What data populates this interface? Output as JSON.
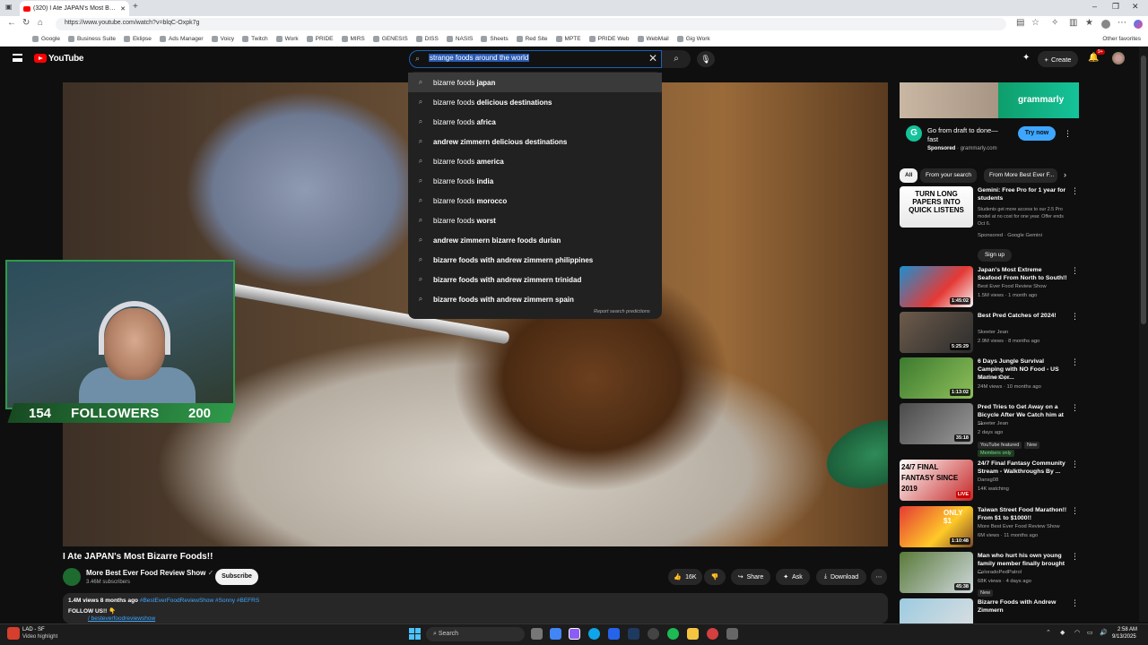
{
  "browser": {
    "tab_title": "(320) I Ate JAPAN's Most Bu...",
    "url": "https://www.youtube.com/watch?v=blqC-Oxpk7g",
    "bookmarks": [
      "Google",
      "Business Suite",
      "Eklipse",
      "Ads Manager",
      "Voicy",
      "Twitch",
      "Work",
      "PRIDE",
      "MIRS",
      "GENESIS",
      "DISS",
      "NASIS",
      "Sheets",
      "Red Site",
      "MPTE",
      "PRIDE Web",
      "WebMail",
      "Gig Work"
    ],
    "other_bookmarks": "Other favorites"
  },
  "header": {
    "logo": "YouTube",
    "search_value": "strange foods around the world",
    "create_label": "Create",
    "notif_count": "9+"
  },
  "suggestions": {
    "items": [
      {
        "prefix": "bizarre foods ",
        "bold": "japan"
      },
      {
        "prefix": "bizarre foods ",
        "bold": "delicious destinations"
      },
      {
        "prefix": "bizarre foods ",
        "bold": "africa"
      },
      {
        "prefix": "",
        "bold": "andrew zimmern delicious destinations"
      },
      {
        "prefix": "bizarre foods ",
        "bold": "america"
      },
      {
        "prefix": "bizarre foods ",
        "bold": "india"
      },
      {
        "prefix": "bizarre foods ",
        "bold": "morocco"
      },
      {
        "prefix": "bizarre foods ",
        "bold": "worst"
      },
      {
        "prefix": "",
        "bold": "andrew zimmern bizarre foods durian"
      },
      {
        "prefix": "",
        "bold": "bizarre foods with andrew zimmern philippines"
      },
      {
        "prefix": "",
        "bold": "bizarre foods with andrew zimmern trinidad"
      },
      {
        "prefix": "",
        "bold": "bizarre foods with andrew zimmern spain"
      }
    ],
    "report": "Report search predictions"
  },
  "overlay": {
    "followers_current": "154",
    "followers_label": "FOLLOWERS",
    "followers_goal": "200"
  },
  "video": {
    "title": "I Ate JAPAN's Most Bizarre Foods!!",
    "channel": "More Best Ever Food Review Show",
    "subs": "3.46M subscribers",
    "subscribe": "Subscribe",
    "likes": "16K",
    "share": "Share",
    "ask": "Ask",
    "download": "Download",
    "views_age": "1.4M views  8 months ago",
    "tags": "#BestEverFoodReviewShow #Sonny #BEFRS",
    "follow": "FOLLOW US!! 👇",
    "link": "/ besteverfoodreviewshow"
  },
  "ad": {
    "brand": "grammarly",
    "title": "Go from draft to done—fast",
    "sponsored": "Sponsored",
    "domain": "grammarly.com",
    "cta": "Try now"
  },
  "chips": [
    "All",
    "From your search",
    "From More Best Ever F..."
  ],
  "recs": [
    {
      "title": "Gemini: Free Pro for 1 year for students",
      "meta1": "Students get more access to our 2.5 Pro model at no cost for one year. Offer ends Oct 6.",
      "meta2": "Sponsored · Google Gemini",
      "duration": "",
      "thumb_text": "TURN LONG PAPERS INTO QUICK LISTENS"
    },
    {
      "title": "Japan's Most Extreme Seafood From North to South!!",
      "meta1": "Best Ever Food Review Show",
      "meta2": "1.5M views · 1 month ago",
      "duration": "1:45:02"
    },
    {
      "title": "Best Pred Catches of 2024!",
      "meta1": "Skeeter Jean",
      "meta2": "2.9M views · 8 months ago",
      "duration": "5:25:29"
    },
    {
      "title": "6 Days Jungle Survival Camping with NO Food - US Marine Cor...",
      "meta1": "Outdoor Boys",
      "meta2": "24M views · 10 months ago",
      "duration": "1:13:02"
    },
    {
      "title": "Pred Tries to Get Away on a Bicycle After We Catch him at ...",
      "meta1": "Skeeter Jean",
      "meta2": "2 days ago",
      "duration": "35:18"
    },
    {
      "title": "24/7 Final Fantasy Community Stream - Walkthroughs By ...",
      "meta1": "Dansg08",
      "meta2": "14K watching",
      "duration": "LIVE"
    },
    {
      "title": "Taiwan Street Food Marathon!! From $1 to $1000!!",
      "meta1": "More Best Ever Food Review Show",
      "meta2": "6M views · 11 months ago",
      "duration": "1:10:48"
    },
    {
      "title": "Man who hurt his own young family member finally brought ...",
      "meta1": "ColoradoPedPatrol",
      "meta2": "68K views · 4 days ago",
      "duration": "45:38"
    },
    {
      "title": "Bizarre Foods with Andrew Zimmern",
      "meta1": "",
      "meta2": "",
      "duration": ""
    }
  ],
  "rec_extras": {
    "signup": "Sign up",
    "yt_featured": "YouTube featured",
    "new": "New",
    "members": "Members only",
    "new2": "New",
    "thumb_final_fantasy": "24/7 FINAL FANTASY SINCE 2019",
    "thumb_only": "ONLY $1"
  },
  "taskbar": {
    "weather_line1": "LAD - SF",
    "weather_line2": "Video highlight",
    "search": "Search",
    "time": "2:58 AM",
    "date": "9/13/2025"
  }
}
